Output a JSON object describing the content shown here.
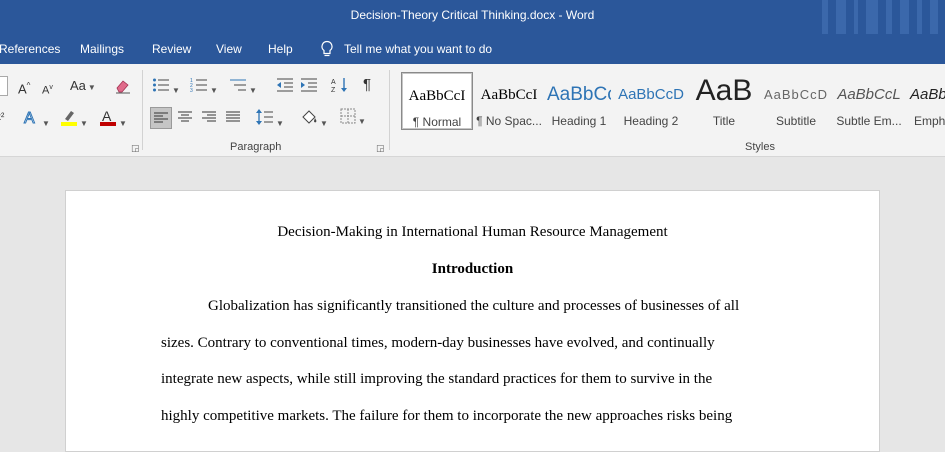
{
  "window": {
    "title": "Decision-Theory Critical Thinking.docx  -  Word"
  },
  "tabs": [
    "References",
    "Mailings",
    "Review",
    "View",
    "Help"
  ],
  "tellme": {
    "label": "Tell me what you want to do"
  },
  "ribbon": {
    "font_group": {
      "grow_label": "A",
      "shrink_label": "A",
      "case_label": "Aa"
    },
    "paragraph_group": {
      "label": "Paragraph"
    },
    "styles_group": {
      "label": "Styles",
      "items": [
        {
          "sample": "AaBbCcI",
          "name": "¶ Normal"
        },
        {
          "sample": "AaBbCcI",
          "name": "¶ No Spac..."
        },
        {
          "sample": "AaBbCc",
          "name": "Heading 1"
        },
        {
          "sample": "AaBbCcD",
          "name": "Heading 2"
        },
        {
          "sample": "AaB",
          "name": "Title"
        },
        {
          "sample": "AaBbCcD",
          "name": "Subtitle"
        },
        {
          "sample": "AaBbCcL",
          "name": "Subtle Em..."
        },
        {
          "sample": "AaBb",
          "name": "Emph"
        }
      ]
    }
  },
  "document": {
    "title": "Decision-Making in International Human Resource Management",
    "heading": "Introduction",
    "lines": [
      "Globalization has significantly transitioned the culture and processes of businesses of all",
      "sizes. Contrary to conventional times, modern-day businesses have evolved, and continually",
      "integrate new aspects, while still improving the standard practices for them to survive in the",
      "highly competitive markets. The failure for them to incorporate the new approaches risks being"
    ]
  },
  "colors": {
    "titlebar": "#2b579a",
    "ribbon": "#f3f3f3",
    "canvas": "#e6e6e6",
    "highlight": "#ffff00",
    "font_red": "#c00000",
    "heading_blue": "#2e74b5"
  }
}
